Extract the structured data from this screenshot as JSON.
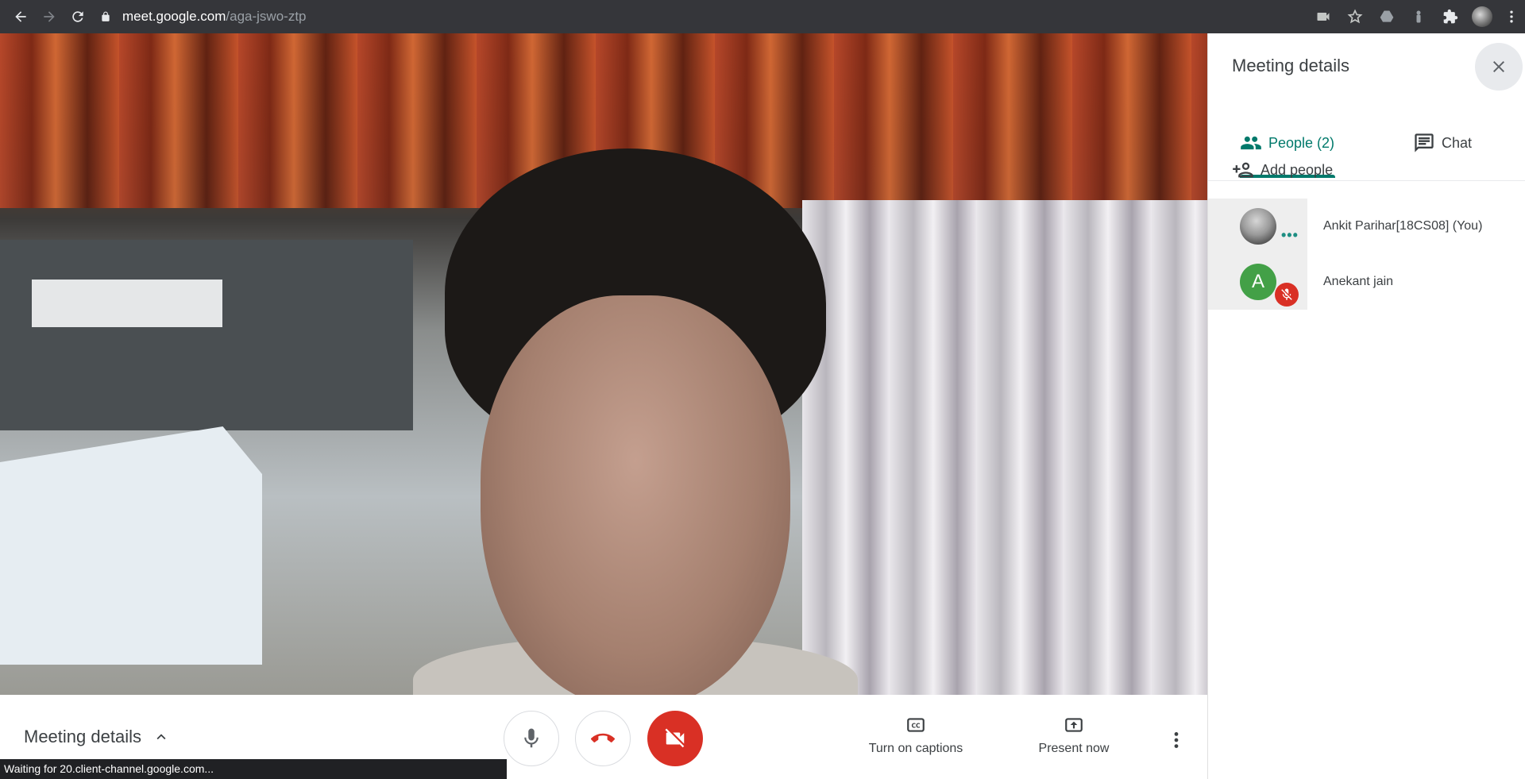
{
  "browser": {
    "url_host": "meet.google.com",
    "url_path": "/aga-jswo-ztp",
    "icons": [
      "back-icon",
      "forward-icon",
      "reload-icon",
      "lock-icon",
      "camera-icon",
      "star-icon",
      "drive-icon",
      "extension-icon",
      "puzzle-icon",
      "profile-avatar",
      "kebab-menu-icon"
    ]
  },
  "controls": {
    "meeting_details_label": "Meeting details",
    "captions_label": "Turn on captions",
    "present_label": "Present now"
  },
  "status_bar": {
    "text": "Waiting for 20.client-channel.google.com..."
  },
  "panel": {
    "title": "Meeting details",
    "tabs": [
      {
        "label": "People (2)",
        "active": true
      },
      {
        "label": "Chat",
        "active": false
      }
    ],
    "add_people_label": "Add people",
    "people": [
      {
        "name": "Ankit Parihar[18CS08] (You)",
        "avatar": "photo",
        "status": "speaking"
      },
      {
        "name": "Anekant jain",
        "avatar_letter": "A",
        "status": "muted"
      }
    ]
  },
  "colors": {
    "accent": "#00796b",
    "danger": "#d93025",
    "avatar_green": "#43a047",
    "toolbar": "#35363a"
  }
}
